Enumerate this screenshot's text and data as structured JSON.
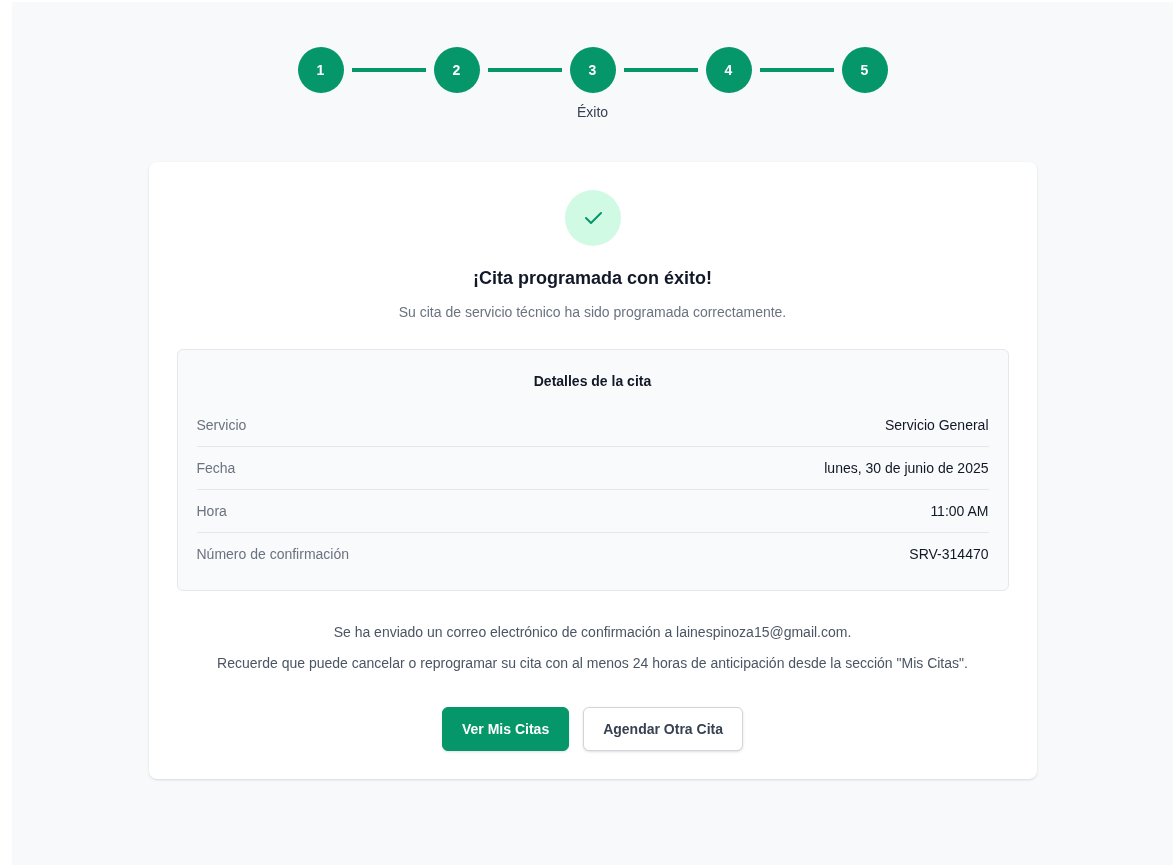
{
  "stepper": {
    "steps": [
      {
        "number": "1",
        "completed": true
      },
      {
        "number": "2",
        "completed": true
      },
      {
        "number": "3",
        "completed": true,
        "label": "Éxito"
      },
      {
        "number": "4",
        "completed": true
      },
      {
        "number": "5",
        "completed": true
      }
    ]
  },
  "success_card": {
    "title": "¡Cita programada con éxito!",
    "subtitle": "Su cita de servicio técnico ha sido programada correctamente.",
    "details": {
      "heading": "Detalles de la cita",
      "rows": [
        {
          "label": "Servicio",
          "value": "Servicio General"
        },
        {
          "label": "Fecha",
          "value": "lunes, 30 de junio de 2025"
        },
        {
          "label": "Hora",
          "value": "11:00 AM"
        },
        {
          "label": "Número de confirmación",
          "value": "SRV-314470"
        }
      ]
    },
    "notes": [
      "Se ha enviado un correo electrónico de confirmación a lainespinoza15@gmail.com.",
      "Recuerde que puede cancelar o reprogramar su cita con al menos 24 horas de anticipación desde la sección \"Mis Citas\"."
    ],
    "buttons": [
      {
        "label": "Ver Mis Citas",
        "kind": "primary"
      },
      {
        "label": "Agendar Otra Cita",
        "kind": "secondary"
      }
    ]
  }
}
